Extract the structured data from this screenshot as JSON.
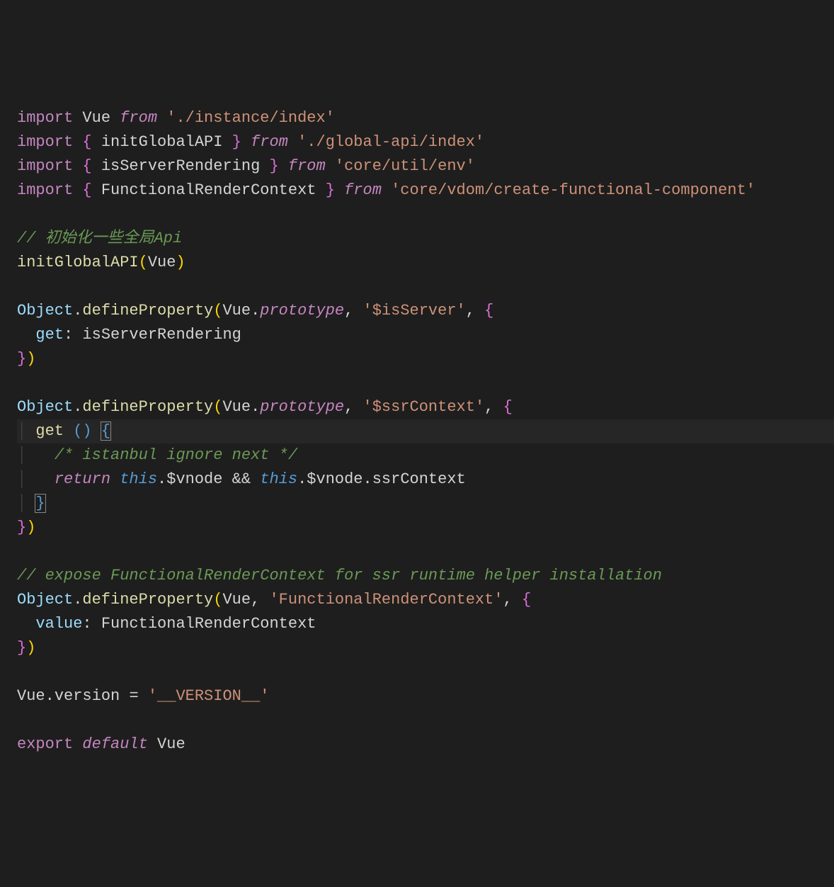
{
  "code": {
    "import_kw": "import",
    "from_kw": "from",
    "vue": "Vue",
    "initGlobalAPI": "initGlobalAPI",
    "isServerRendering": "isServerRendering",
    "FunctionalRenderContext": "FunctionalRenderContext",
    "path_instance": "'./instance/index'",
    "path_globalapi": "'./global-api/index'",
    "path_env": "'core/util/env'",
    "path_cfc": "'core/vdom/create-functional-component'",
    "comment_init": "// 初始化一些全局Api",
    "Object": "Object",
    "defineProperty": "defineProperty",
    "prototype": "prototype",
    "str_isServer": "'$isServer'",
    "get": "get",
    "str_ssrContext": "'$ssrContext'",
    "comment_istanbul": "/* istanbul ignore next */",
    "return_kw": "return",
    "this_kw": "this",
    "vnode": "$vnode",
    "ssrContext": "ssrContext",
    "amp": "&&",
    "comment_expose": "// expose FunctionalRenderContext for ssr runtime helper installation",
    "str_FRC": "'FunctionalRenderContext'",
    "value": "value",
    "version": "version",
    "str_version": "'__VERSION__'",
    "export_kw": "export",
    "default_kw": "default",
    "lbrace": "{",
    "rbrace": "}",
    "lparen": "(",
    "rparen": ")",
    "comma": ",",
    "dot": ".",
    "colon": ":",
    "eq": "=",
    "empty_parens": "()"
  }
}
